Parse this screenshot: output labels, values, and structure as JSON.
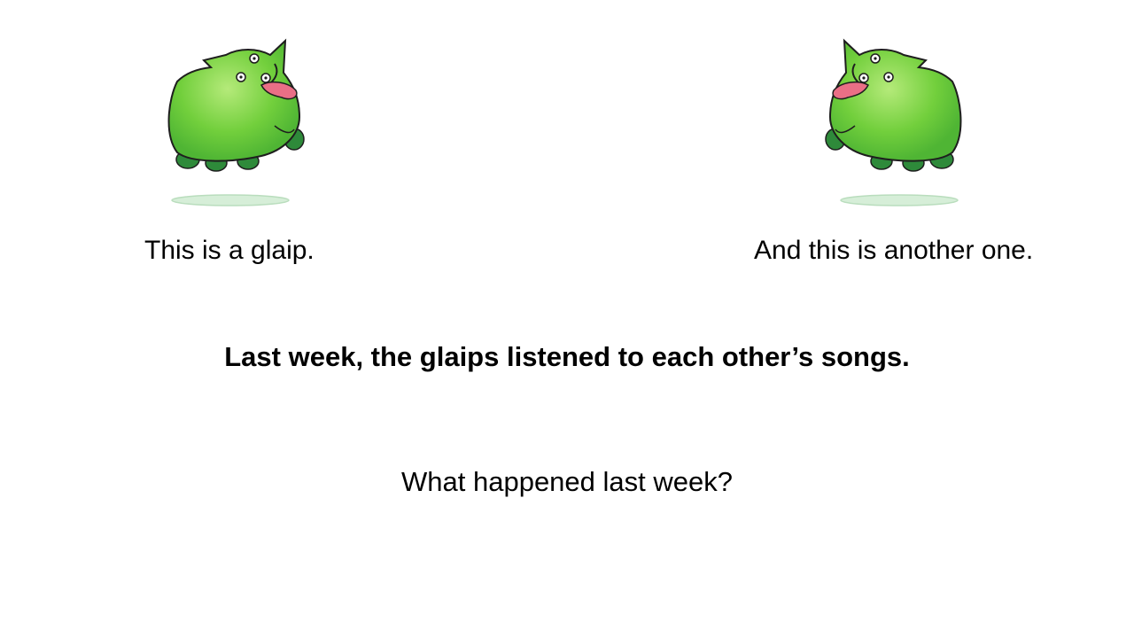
{
  "slide": {
    "caption_left": "This is a glaip.",
    "caption_right": "And this is another one.",
    "statement": "Last week, the glaips listened to each other’s songs.",
    "question": "What happened last week?"
  },
  "illustrations": {
    "left": "glaip-creature-facing-right",
    "right": "glaip-creature-facing-left"
  },
  "colors": {
    "body_green": "#6fcf3a",
    "body_light": "#a9e56e",
    "feet_dark": "#2e8a3a",
    "tongue": "#ea6f86",
    "shadow": "#cfead2"
  }
}
